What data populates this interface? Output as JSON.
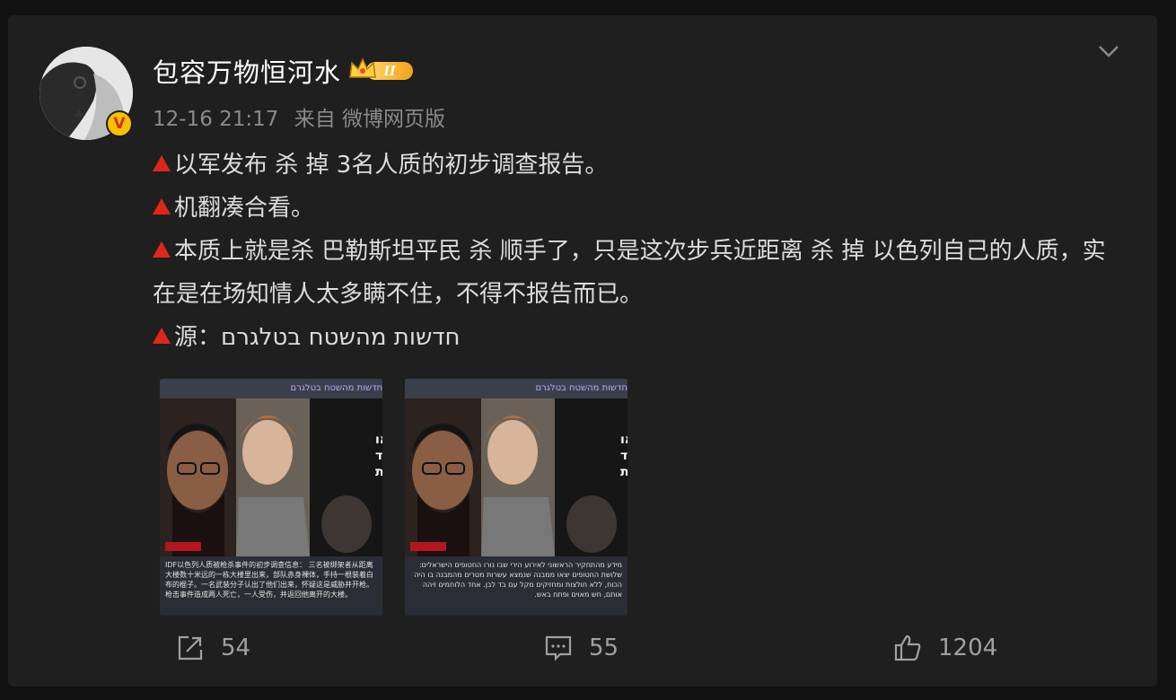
{
  "post": {
    "author": "包容万物恒河水",
    "level_badge": "II",
    "time": "12-16 21:17",
    "source": "来自 微博网页版",
    "lines": [
      "以军发布 杀 掉 3名人质的初步调查报告。",
      "机翻凑合看。",
      "本质上就是杀 巴勒斯坦平民 杀 顺手了，只是这次步兵近距离 杀 掉 以色列自己的人质，实在是在场知情人太多瞒不住，不得不报告而已。",
      "源：חדשות מהשטח בטלגרם"
    ]
  },
  "images": [
    {
      "channel": "חדשות מהשטח בטלגרם",
      "headline": "החטופים יצאו ממבנה עם בד לבן וידיים מורמות",
      "caption": "IDF以色列人质被枪杀事件的初步调查信息：\n三名被绑架者从距离大楼数十米远的一栋大楼里出来，部队赤身裸体，手持一根装着白布的棍子。一名武装分子认出了他们出来，怀疑这是威胁并开枪。枪击事件造成两人死亡，一人受伤，并返回他离开的大楼。"
    },
    {
      "channel": "חדשות מהשטח בטלגרם",
      "headline": "החטופים יצאו ממבנה עם בד לבן וידיים מורמות",
      "caption": "מידע מהתחקיר הראשוני לאירוע הירי שבו נורו החטופים הישראלים:\nשלושת החטופים יצאו ממבנה שנמצא עשרות מטרים מהמבנה בו היה הכוח, ללא חולצות ומחזיקים מקל עם בד לבן. אחד הלוחמים זיהה אותם, חש מאוים ופתח באש."
    }
  ],
  "actions": {
    "repost_count": "54",
    "comment_count": "55",
    "like_count": "1204"
  },
  "colors": {
    "background": "#121212",
    "card": "#1f1f1f",
    "accent_triangle": "#e0261c",
    "vip_badge": "#f7c100"
  }
}
